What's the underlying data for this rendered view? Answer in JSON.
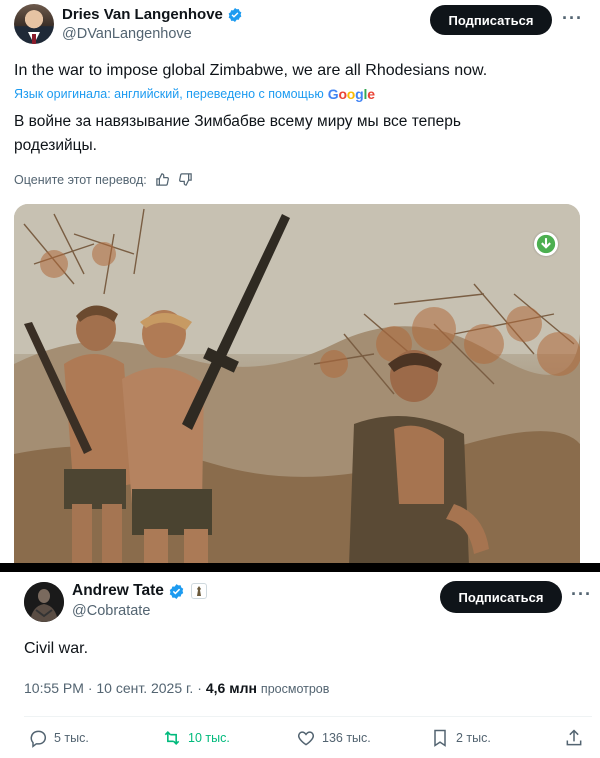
{
  "tweet1": {
    "author_name": "Dries Van Langenhove",
    "author_handle": "@DVanLangenhove",
    "subscribe_label": "Подписаться",
    "more_label": "···",
    "text": "In the war to impose global Zimbabwe, we are all Rhodesians now.",
    "translation_note": "Язык оригинала: английский, переведено с помощью",
    "translation_provider": [
      "G",
      "o",
      "o",
      "g",
      "l",
      "e"
    ],
    "translated_text": "В войне за навязывание Зимбабве всему миру мы все теперь родезийцы.",
    "rate_label": "Оцените этот перевод:",
    "icons": [
      "verified-badge-icon",
      "thumbs-up-icon",
      "thumbs-down-icon",
      "download-icon"
    ]
  },
  "tweet2": {
    "author_name": "Andrew Tate",
    "author_handle": "@Cobratate",
    "subscribe_label": "Подписаться",
    "more_label": "···",
    "text": "Civil war.",
    "time": "10:55 PM · 10 сент. 2025 г. ·",
    "views_count": "4,6 млн",
    "views_label": "просмотров",
    "actions": {
      "replies": "5 тыс.",
      "reposts": "10 тыс.",
      "likes": "136 тыс.",
      "bookmarks": "2 тыс."
    },
    "colors": {
      "repost_active": "#00ba7c",
      "verified": "#1d9bf0"
    }
  }
}
